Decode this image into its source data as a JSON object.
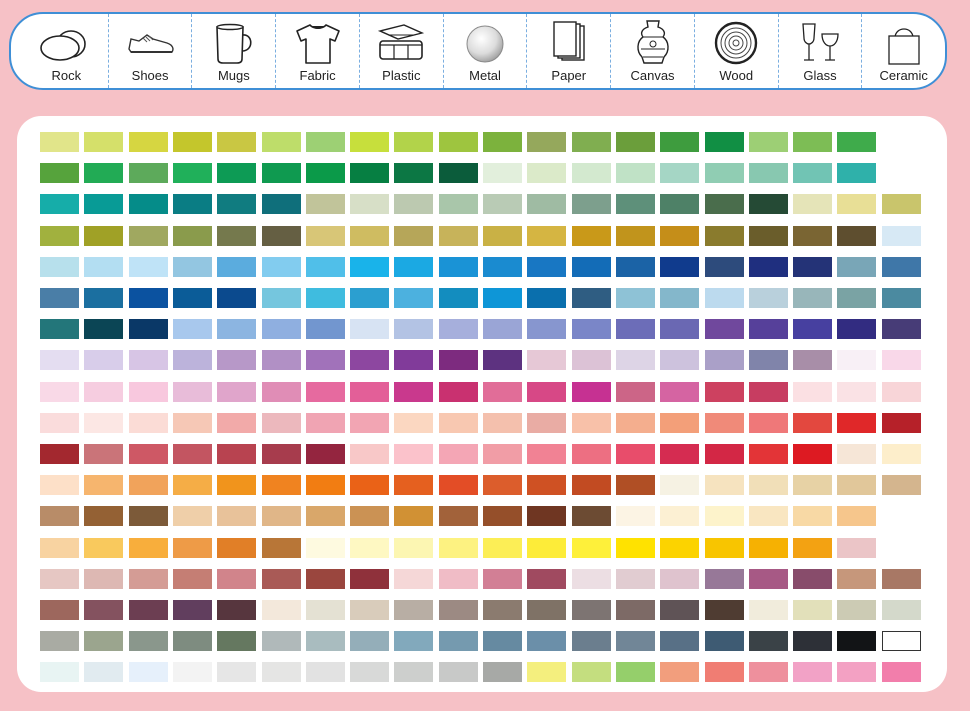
{
  "surfaces": [
    {
      "label": "Rock",
      "icon": "rock-icon"
    },
    {
      "label": "Shoes",
      "icon": "shoes-icon"
    },
    {
      "label": "Mugs",
      "icon": "mug-icon"
    },
    {
      "label": "Fabric",
      "icon": "tshirt-icon"
    },
    {
      "label": "Plastic",
      "icon": "plastic-container-icon"
    },
    {
      "label": "Metal",
      "icon": "metal-disc-icon"
    },
    {
      "label": "Paper",
      "icon": "paper-stack-icon"
    },
    {
      "label": "Canvas",
      "icon": "vase-icon"
    },
    {
      "label": "Wood",
      "icon": "wood-slice-icon"
    },
    {
      "label": "Glass",
      "icon": "wine-glasses-icon"
    },
    {
      "label": "Ceramic",
      "icon": "tote-bag-icon"
    }
  ],
  "palette": {
    "rows": [
      [
        "#e1e58a",
        "#d5e06a",
        "#d6d641",
        "#c4c62c",
        "#c9c743",
        "#bedd6a",
        "#9dd074",
        "#c7df3c",
        "#b2d34a",
        "#9ec53f",
        "#7cb23d",
        "#95a85c",
        "#80ae50",
        "#6b9e3b",
        "#3e9c3e",
        "#118f44",
        "#9dcf75",
        "#7dbd55",
        "#3fab4b"
      ],
      [
        "#56a33c",
        "#22ab55",
        "#5daa5b",
        "#20b05a",
        "#0d9b55",
        "#0f9a50",
        "#0b9a49",
        "#067f42",
        "#0c7744",
        "#0b5c3b",
        "#e2efdc",
        "#dbeac9",
        "#d3e9cf",
        "#c0e2c6",
        "#a5d6c5",
        "#90cdb3",
        "#88c8b0",
        "#71c4b4",
        "#2fb1aa"
      ],
      [
        "#16ada9",
        "#089b96",
        "#058c89",
        "#0a7d84",
        "#107c80",
        "#0f6f7b",
        "#c1c49a",
        "#d7dfc7",
        "#bcc9b0",
        "#a9c6aa",
        "#b9cbb5",
        "#9fbba3",
        "#7d9f8d",
        "#5e907a",
        "#4e8167",
        "#4a6d4c",
        "#254a35",
        "#e5e4b8",
        "#e8df96",
        "#c9c56c"
      ],
      [
        "#a1b13e",
        "#a0a126",
        "#a0a860",
        "#8a9b4c",
        "#75794d",
        "#655f43",
        "#d8c677",
        "#cfbc61",
        "#b6a659",
        "#c7b35a",
        "#c9b145",
        "#d5b542",
        "#c99919",
        "#c1941c",
        "#c58e19",
        "#8a7b2d",
        "#6a5d2b",
        "#7a6533",
        "#5e4e2f",
        "#d7e9f5"
      ],
      [
        "#b7e0ec",
        "#b3def2",
        "#bfe3f7",
        "#93c6e1",
        "#5bacde",
        "#82ccef",
        "#50bfe9",
        "#19b3ea",
        "#1ba9e3",
        "#1a93d6",
        "#1a8bd0",
        "#1877c3",
        "#136cb7",
        "#1b63a6",
        "#103b8d",
        "#2d4b7c",
        "#1f2f7f",
        "#243377",
        "#79a6b7",
        "#3f77a8"
      ],
      [
        "#4a7ea7",
        "#1b6fa0",
        "#0b52a0",
        "#0b5c98",
        "#0b4a8e",
        "#75c6de",
        "#3fbcdf",
        "#2b9fd0",
        "#4cb1df",
        "#138dbf",
        "#0e96d7",
        "#0a6fad",
        "#2f5d82",
        "#8ec2d6",
        "#84b7cb",
        "#bcdaee",
        "#b9d0dc",
        "#98b6ba",
        "#7aa3a4",
        "#4b8aa0"
      ],
      [
        "#23767a",
        "#0b4555",
        "#0a3867",
        "#a8c8ed",
        "#8cb5e1",
        "#8fafe0",
        "#7296cf",
        "#d7e3f3",
        "#b3c3e4",
        "#a6afdc",
        "#9aa5d6",
        "#8796cf",
        "#7a86c8",
        "#6c6db8",
        "#6a68b3",
        "#70489d",
        "#56409a",
        "#4740a0",
        "#322c81",
        "#473c77"
      ],
      [
        "#e4ddf1",
        "#d8cdea",
        "#d7c5e5",
        "#bcb3db",
        "#b798c8",
        "#b190c5",
        "#a172ba",
        "#8d47a0",
        "#813b9a",
        "#7d2b7f",
        "#5d3280",
        "#e6c8d6",
        "#dcc2d6",
        "#ddd4e6",
        "#cdc2dd",
        "#aaa0c8",
        "#8084aa",
        "#a88ea8",
        "#f8f0f6",
        "#f9d8e9"
      ],
      [
        "#f9d9e7",
        "#f6cde0",
        "#f8c8de",
        "#e8bcd9",
        "#e0a5cb",
        "#e08db6",
        "#e66a9f",
        "#e35f98",
        "#c9398d",
        "#c93170",
        "#e16d98",
        "#d74886",
        "#c63192",
        "#cc6587",
        "#d564a2",
        "#cd4160",
        "#c73d61",
        "#fbe0e3",
        "#fae2e5",
        "#f8d5d8"
      ],
      [
        "#fadcdc",
        "#fce7e4",
        "#fbdcd6",
        "#f6c8b6",
        "#f2aaa9",
        "#ecb8bd",
        "#f0a4b3",
        "#f2a5b3",
        "#fbd7c1",
        "#f8c8b1",
        "#f4c0ad",
        "#e9aca4",
        "#f8c1a9",
        "#f4ae8e",
        "#f39f79",
        "#f08a79",
        "#ef7879",
        "#e3483f",
        "#e02829",
        "#b62129"
      ],
      [
        "#a3282f",
        "#ca7479",
        "#ce5865",
        "#c35561",
        "#b84350",
        "#a73c4d",
        "#94253f",
        "#f8c8c8",
        "#fbc2cb",
        "#f4a6b5",
        "#f19da6",
        "#f18294",
        "#ed6f82",
        "#e84d6b",
        "#d52c51",
        "#d32745",
        "#e33437",
        "#dd1a22",
        "#f6e6d7",
        "#fdeecb"
      ],
      [
        "#fde0c8",
        "#f6b56e",
        "#f1a35b",
        "#f5ad46",
        "#f1941c",
        "#f08320",
        "#f27d12",
        "#ea6217",
        "#e5601f",
        "#e34d26",
        "#dc5d2c",
        "#cf5123",
        "#c24b22",
        "#b04f25",
        "#f6f2e3",
        "#f6e3bf",
        "#f1dfb8",
        "#e7d2a5",
        "#e1c79a",
        "#d4b58e"
      ],
      [
        "#b88c68",
        "#946134",
        "#7c5a39",
        "#efcfa9",
        "#e8c29a",
        "#e0b688",
        "#d9a76a",
        "#cb9254",
        "#d19134",
        "#a2623a",
        "#954f2a",
        "#6f3622",
        "#6c4b33",
        "#fcf4e4",
        "#fcf0d3",
        "#fdf3cb",
        "#f9e6c1",
        "#f8d9a5",
        "#f6c68c"
      ],
      [
        "#f8d3a1",
        "#f9c95d",
        "#f8ae3c",
        "#ee9b47",
        "#e17f27",
        "#b87637",
        "#fefae0",
        "#fef8c2",
        "#fcf6b2",
        "#fdf281",
        "#fcee56",
        "#fdec39",
        "#fef03a",
        "#ffe200",
        "#fcd300",
        "#f8c500",
        "#f6b102",
        "#f3a212",
        "#ebc5c7"
      ],
      [
        "#e6c7c3",
        "#ddb8b3",
        "#d49c95",
        "#c57e74",
        "#d1848b",
        "#a95a56",
        "#9a463e",
        "#8f313b",
        "#f5d7d7",
        "#f0bcc6",
        "#d27f95",
        "#a04a60",
        "#ecdee3",
        "#e1ccd1",
        "#dfc3ce",
        "#977898",
        "#a75985",
        "#884c6b",
        "#c6977b",
        "#a87865"
      ],
      [
        "#9d675d",
        "#84525f",
        "#6c3e52",
        "#613e5e",
        "#57363e",
        "#f3e8db",
        "#e4e1d3",
        "#d9ccbb",
        "#b8aea4",
        "#9c8a83",
        "#8b7b6f",
        "#7f7266",
        "#7d7472",
        "#7d6a66",
        "#5f5356",
        "#4f3c32",
        "#f1ecdc",
        "#e2e0ba",
        "#cccbb4",
        "#d4d9cb"
      ],
      [
        "#a9aba3",
        "#9ba58e",
        "#8a978c",
        "#7e8c80",
        "#657860",
        "#b0b9ba",
        "#a9bcbf",
        "#94aeb9",
        "#82a9bc",
        "#759aaf",
        "#668aa1",
        "#6b8fa9",
        "#6b7e8e",
        "#718697",
        "#587086",
        "#3e5b73",
        "#3a4247",
        "#2d3037",
        "#121416",
        "#ffffff"
      ],
      [
        "#e8f4f3",
        "#e1ebf0",
        "#e6f0fb",
        "#f3f3f3",
        "#e6e6e6",
        "#e5e5e4",
        "#e2e2e2",
        "#d8d9d8",
        "#cdcfcd",
        "#c8c9c8",
        "#a7a9a6",
        "#f4ef7e",
        "#c4de7f",
        "#95cf6b",
        "#f29e7d",
        "#f07d73",
        "#ee909d",
        "#f2a2c6",
        "#f3a1c3",
        "#f27eab"
      ]
    ]
  }
}
